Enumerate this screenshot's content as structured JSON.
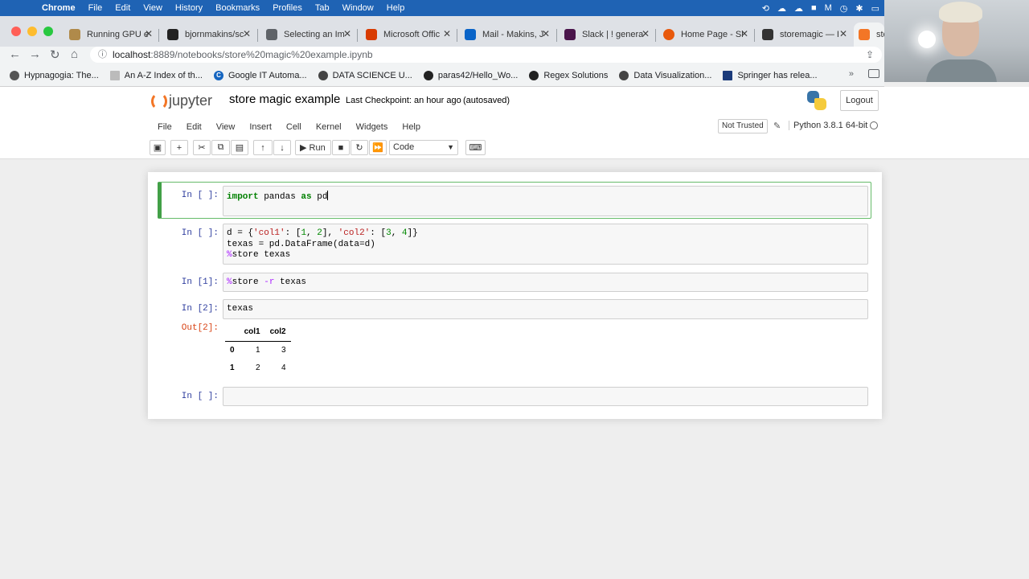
{
  "os_menu": {
    "app": "Chrome",
    "items": [
      "File",
      "Edit",
      "View",
      "History",
      "Bookmarks",
      "Profiles",
      "Tab",
      "Window",
      "Help"
    ]
  },
  "tabs": [
    {
      "label": "Running GPU e",
      "icon_color": "#b08a4a",
      "icon": "box-icon"
    },
    {
      "label": "bjornmakins/sc",
      "icon_color": "#222222",
      "icon": "github-icon"
    },
    {
      "label": "Selecting an Im",
      "icon_color": "#5f6368",
      "icon": "doc-icon"
    },
    {
      "label": "Microsoft Offic",
      "icon_color": "#d83b01",
      "icon": "office-icon"
    },
    {
      "label": "Mail - Makins, J",
      "icon_color": "#0a64c8",
      "icon": "outlook-icon"
    },
    {
      "label": "Slack | ! genera",
      "icon_color": "#4a154b",
      "icon": "slack-icon"
    },
    {
      "label": "Home Page - Sl",
      "icon_color": "#e8590c",
      "icon": "ring-icon"
    },
    {
      "label": "storemagic — I",
      "icon_color": "#333333",
      "icon": "page-icon"
    },
    {
      "label": "sto",
      "icon_color": "#f37626",
      "icon": "jupyter-icon"
    }
  ],
  "address": {
    "host": "localhost",
    "path": ":8889/notebooks/store%20magic%20example.ipynb"
  },
  "bookmarks": [
    {
      "label": "Hypnagogia: The...",
      "color": "#555555"
    },
    {
      "label": "An A-Z Index of th...",
      "color": "#bbbbbb"
    },
    {
      "label": "Google IT Automa...",
      "color": "#1565c0"
    },
    {
      "label": "DATA SCIENCE U...",
      "color": "#444444"
    },
    {
      "label": "paras42/Hello_Wo...",
      "color": "#222222"
    },
    {
      "label": "Regex Solutions",
      "color": "#222222"
    },
    {
      "label": "Data Visualization...",
      "color": "#444444"
    },
    {
      "label": "Springer has relea...",
      "color": "#1a3a7a"
    }
  ],
  "jupyter": {
    "logo_text": "jupyter",
    "notebook_name": "store magic example",
    "checkpoint": "Last Checkpoint: an hour ago",
    "autosave": "(autosaved)",
    "logout": "Logout",
    "menu": [
      "File",
      "Edit",
      "View",
      "Insert",
      "Cell",
      "Kernel",
      "Widgets",
      "Help"
    ],
    "trust": "Not Trusted",
    "kernel": "Python 3.8.1 64-bit",
    "run_label": "Run",
    "cell_type": "Code"
  },
  "cells": [
    {
      "prompt": "In [ ]:"
    },
    {
      "prompt": "In [ ]:"
    },
    {
      "prompt": "In [1]:"
    },
    {
      "prompt": "In [2]:"
    },
    {
      "prompt": "In [ ]:"
    }
  ],
  "output": {
    "prompt": "Out[2]:",
    "columns": [
      "col1",
      "col2"
    ],
    "rows": [
      {
        "index": "0",
        "values": [
          "1",
          "3"
        ]
      },
      {
        "index": "1",
        "values": [
          "2",
          "4"
        ]
      }
    ]
  },
  "code": {
    "c1": {
      "kw": "import",
      "mid": " pandas ",
      "kw2": "as",
      "end": " pd"
    },
    "c2": {
      "l1a": "d = {",
      "s1": "'col1'",
      "l1b": ": [",
      "n1": "1",
      "l1c": ", ",
      "n2": "2",
      "l1d": "], ",
      "s2": "'col2'",
      "l1e": ": [",
      "n3": "3",
      "l1f": ", ",
      "n4": "4",
      "l1g": "]}",
      "l2": "texas = pd.DataFrame(data=d)",
      "m3": "%",
      "l3": "store texas"
    },
    "c3": {
      "m": "%",
      "a": "store ",
      "flag": "-r",
      "b": " texas"
    },
    "c4": "texas"
  }
}
